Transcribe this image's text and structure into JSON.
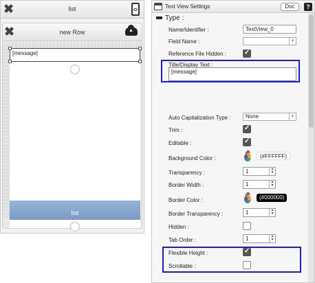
{
  "designer": {
    "top_title": "list",
    "row_title": "new Row",
    "field_text": "[message]",
    "footer_label": "list"
  },
  "settings": {
    "window_title": "Text View Settings",
    "doc_label": "Doc",
    "help_label": "?",
    "type_label": "Type :",
    "fields": {
      "name_label": "Name/Identifier :",
      "name_value": "TextView_0",
      "field_name_label": "Field Name :",
      "field_name_value": "",
      "ref_hidden_label": "Reference File Hidden :",
      "ref_hidden_checked": true,
      "title_label": "Title/Display Text :",
      "title_value": "[message]",
      "autocap_label": "Auto Capitalization Type :",
      "autocap_value": "None",
      "trim_label": "Trim :",
      "trim_checked": true,
      "editable_label": "Editable :",
      "editable_checked": true,
      "bg_color_label": "Background Color :",
      "bg_color_value": "(#FFFFFF)",
      "transparency_label": "Transparency :",
      "transparency_value": "1",
      "border_width_label": "Border Width :",
      "border_width_value": "1",
      "border_color_label": "Border Color :",
      "border_color_value": "(#000000)",
      "border_transparency_label": "Border Transparency :",
      "border_transparency_value": "1",
      "hidden_label": "Hidden :",
      "hidden_checked": false,
      "tab_order_label": "Tab Order :",
      "tab_order_value": "1",
      "flexible_height_label": "Flexible Height :",
      "flexible_height_checked": true,
      "scrollable_label": "Scrollable :",
      "scrollable_checked": false
    }
  },
  "colors": {
    "highlight": "#1a1ad8",
    "list_bar": "#8aa9d0"
  }
}
